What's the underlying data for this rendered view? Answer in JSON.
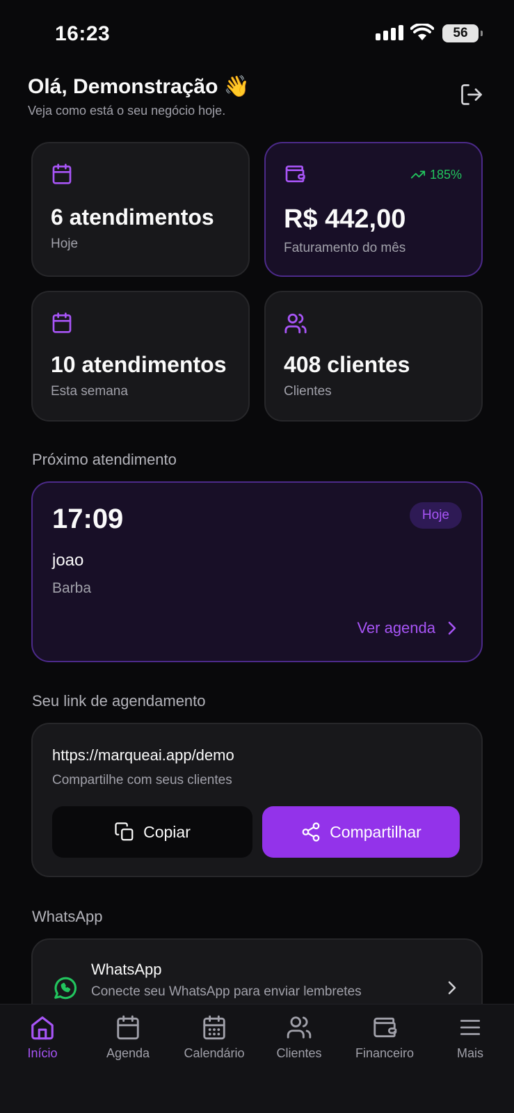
{
  "status_bar": {
    "time": "16:23",
    "battery": "56"
  },
  "header": {
    "greeting": "Olá, Demonstração 👋",
    "subtitle": "Veja como está o seu negócio hoje."
  },
  "stats": [
    {
      "value": "6 atendimentos",
      "label": "Hoje",
      "icon": "calendar-icon"
    },
    {
      "value": "R$ 442,00",
      "label": "Faturamento do mês",
      "icon": "wallet-icon",
      "trend": "185%"
    },
    {
      "value": "10 atendimentos",
      "label": "Esta semana",
      "icon": "calendar-icon"
    },
    {
      "value": "408 clientes",
      "label": "Clientes",
      "icon": "users-icon"
    }
  ],
  "next_appointment": {
    "section_title": "Próximo atendimento",
    "time": "17:09",
    "client": "joao",
    "service": "Barba",
    "badge": "Hoje",
    "action": "Ver agenda"
  },
  "booking_link": {
    "section_title": "Seu link de agendamento",
    "url": "https://marqueai.app/demo",
    "hint": "Compartilhe com seus clientes",
    "copy_label": "Copiar",
    "share_label": "Compartilhar"
  },
  "whatsapp": {
    "section_title": "WhatsApp",
    "title": "WhatsApp",
    "subtitle": "Conecte seu WhatsApp para enviar lembretes"
  },
  "tabs": [
    {
      "label": "Início",
      "icon": "home-icon",
      "active": true
    },
    {
      "label": "Agenda",
      "icon": "calendar-icon"
    },
    {
      "label": "Calendário",
      "icon": "calendar-grid-icon"
    },
    {
      "label": "Clientes",
      "icon": "users-icon"
    },
    {
      "label": "Financeiro",
      "icon": "wallet-icon"
    },
    {
      "label": "Mais",
      "icon": "menu-icon"
    }
  ],
  "colors": {
    "accent": "#a855f7",
    "accent_button": "#9333ea",
    "positive": "#22c55e",
    "whatsapp": "#22c55e",
    "background": "#09090b",
    "card": "#18181b"
  }
}
